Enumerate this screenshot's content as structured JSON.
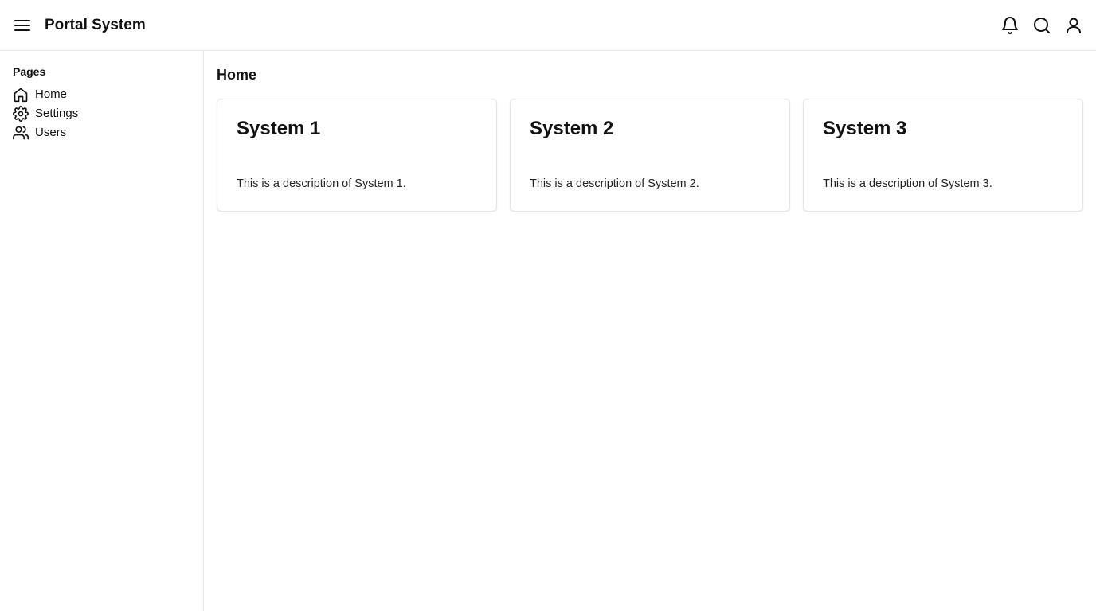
{
  "header": {
    "title": "Portal System",
    "menu_icon": "menu-icon",
    "icons": [
      "bell-icon",
      "search-icon",
      "user-icon"
    ]
  },
  "sidebar": {
    "heading": "Pages",
    "items": [
      {
        "label": "Home",
        "icon": "home-icon"
      },
      {
        "label": "Settings",
        "icon": "gear-icon"
      },
      {
        "label": "Users",
        "icon": "users-icon"
      }
    ]
  },
  "main": {
    "title": "Home",
    "cards": [
      {
        "title": "System 1",
        "description": "This is a description of System 1."
      },
      {
        "title": "System 2",
        "description": "This is a description of System 2."
      },
      {
        "title": "System 3",
        "description": "This is a description of System 3."
      }
    ]
  }
}
